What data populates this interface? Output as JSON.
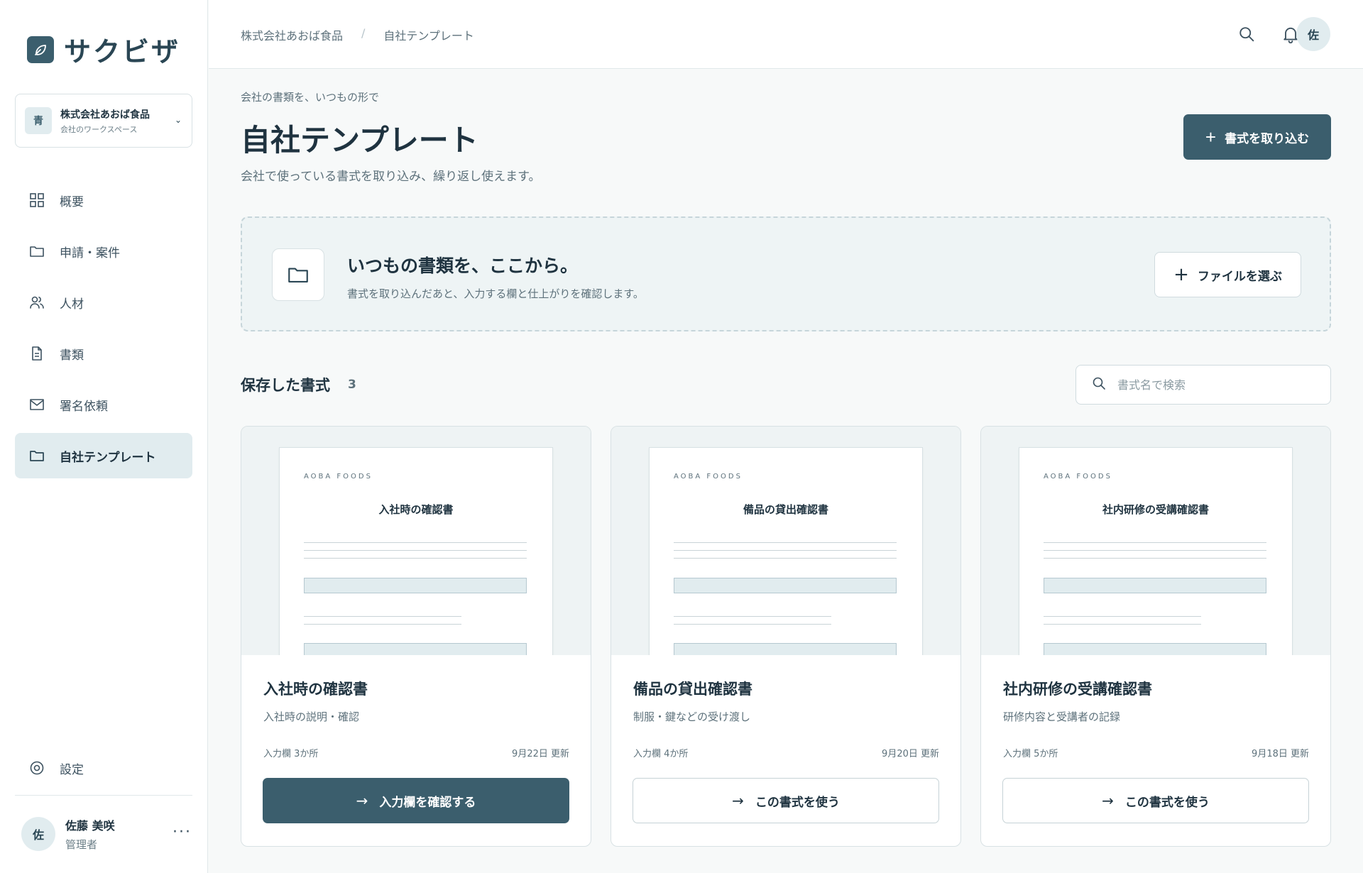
{
  "app": {
    "name": "サクビザ",
    "brand_color": "#3b5e6d"
  },
  "workspace": {
    "badge": "青",
    "name": "株式会社あおば食品",
    "sub": "会社のワークスペース",
    "chevron": "⌄"
  },
  "sidebar": {
    "items": [
      {
        "label": "概要",
        "icon": "grid-icon",
        "active": false
      },
      {
        "label": "申請・案件",
        "icon": "folder-icon",
        "active": false
      },
      {
        "label": "人材",
        "icon": "people-icon",
        "active": false
      },
      {
        "label": "書類",
        "icon": "document-icon",
        "active": false
      },
      {
        "label": "署名依頼",
        "icon": "mail-icon",
        "active": false
      },
      {
        "label": "自社テンプレート",
        "icon": "folder-icon",
        "active": true
      }
    ],
    "settings_label": "設定"
  },
  "user": {
    "avatar": "佐",
    "name": "佐藤 美咲",
    "role": "管理者",
    "more": "···"
  },
  "topbar": {
    "breadcrumb": [
      "株式会社あおば食品",
      "自社テンプレート"
    ],
    "breadcrumb_sep": "/",
    "avatar": "佐"
  },
  "page": {
    "eyebrow": "会社の書類を、いつもの形で",
    "title": "自社テンプレート",
    "subtitle": "会社で使っている書式を取り込み、繰り返し使えます。",
    "import_button": "書式を取り込む"
  },
  "dropzone": {
    "title": "いつもの書類を、ここから。",
    "subtitle": "書式を取り込んだあと、入力する欄と仕上がりを確認します。",
    "button": "ファイルを選ぶ"
  },
  "saved": {
    "title": "保存した書式",
    "count": "3",
    "search_placeholder": "書式名で検索"
  },
  "templates": [
    {
      "brand": "AOBA FOODS",
      "doc_title": "入社時の確認書",
      "title": "入社時の確認書",
      "description": "入社時の説明・確認",
      "fields": "入力欄 3か所",
      "updated": "9月22日 更新",
      "button": "入力欄を確認する",
      "primary": true
    },
    {
      "brand": "AOBA FOODS",
      "doc_title": "備品の貸出確認書",
      "title": "備品の貸出確認書",
      "description": "制服・鍵などの受け渡し",
      "fields": "入力欄 4か所",
      "updated": "9月20日 更新",
      "button": "この書式を使う",
      "primary": false
    },
    {
      "brand": "AOBA FOODS",
      "doc_title": "社内研修の受講確認書",
      "title": "社内研修の受講確認書",
      "description": "研修内容と受講者の記録",
      "fields": "入力欄 5か所",
      "updated": "9月18日 更新",
      "button": "この書式を使う",
      "primary": false
    }
  ]
}
